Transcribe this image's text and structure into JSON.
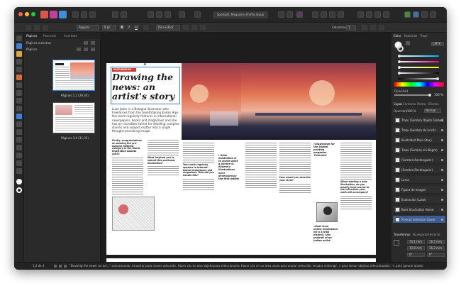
{
  "window": {
    "title": "Spotlight_Magazine_Profile.afpub"
  },
  "context_toolbar": {
    "font_style": "Regular",
    "font_size": "8 pt",
    "style_name": "[Sin estilo]",
    "columns_label": "Columnas",
    "columns_value": "1"
  },
  "left_panel": {
    "tabs": [
      "Páginas",
      "Recursos",
      "Insertado"
    ],
    "section_master": "Páginas maestras",
    "section_pages": "Páginas",
    "thumb_labels": [
      "Páginas 1,2 (29,30)",
      "Páginas 3,4 (31,32)"
    ]
  },
  "spread": {
    "tag": "INSPIRATION",
    "headline": "Drawing the news: an artist's story",
    "standfirst": "Luke Jaker is a Bologna illustrator who freelances from the breathtaking Eolian Alps. Her work regularly features in international newspapers, books and magazines and she has an incredible talent for distilling complex stories and subject matter into a single thought-provoking image.",
    "caption_left": "I think illustration is to words what a picture is. Rubens's illustrations were developed by the first artists",
    "sub_q1": "Firstly, congratulations on winning the pre-Autumn editorial category in the World Illustration Awards (AOI)!",
    "sub_q2": "What inspired you to submit this particular illustration?",
    "sub_q3": "Your work regularly appears in internet-based newspapers and magazines. How did you handle this?",
    "sub_q4": "How would you describe your style?",
    "sub_q5": "When starting a new illustration, do you usually have access to the full article your work will accompany?",
    "caption_right1": "«Illustration for the Digital printing magazine 'Polemica'",
    "caption_right2": "«Beat from online illustration for a Syrian historic, this portrait of an Indian artist."
  },
  "right_panel": {
    "tabs_top": [
      "Color",
      "Muestras",
      "Trazo"
    ],
    "color_mode": "CMYK",
    "opacity_label": "Opacidad",
    "opacity_value": "100 %",
    "tabs_mid": [
      "Capas",
      "Contorno",
      "Paleta",
      "Efectos"
    ],
    "blend_label": "Opacidad:",
    "blend_value": "100 %",
    "blend_mode": "Normal",
    "layers": [
      "Trazo (Sombra Objeto Global)",
      "Trazo (Sombra de la Int)",
      "Illustrated Main Story",
      "Trazo (Sombra sin Negro)",
      "(Sombra Rectangular)",
      "(Sombra Rectangular)",
      "Lomo",
      "Figura de imagen",
      "Ilustración (Luke)",
      "Back Illustration Home",
      "Portrait Selection Guide"
    ],
    "selected_layer": 10,
    "tabs_bottom": [
      "Transformar",
      "Navegador",
      "Historial"
    ],
    "transform": {
      "x": "74,1 mm",
      "y": "10,8 mm",
      "w": "16,5 mm",
      "h": "16,2 mm",
      "r": "0°",
      "s": "0°"
    }
  },
  "status": {
    "zoom": "1,2 de 4",
    "hint": "\"Drawing the news: an art...\" seleccionado. Arrastrar para mover selección. Hacer clic en otro objeto para seleccionarlo. Hacer clic en un área vacía para anular selección. ⌘ para restringir. ⇧ para tomar objetos seleccionados. ⌥ para ignorar ajuste."
  },
  "colors": {
    "accent_blue": "#3f7fd8",
    "headline_tag": "#d23b2f",
    "window_bg": "#2b2b2b"
  }
}
